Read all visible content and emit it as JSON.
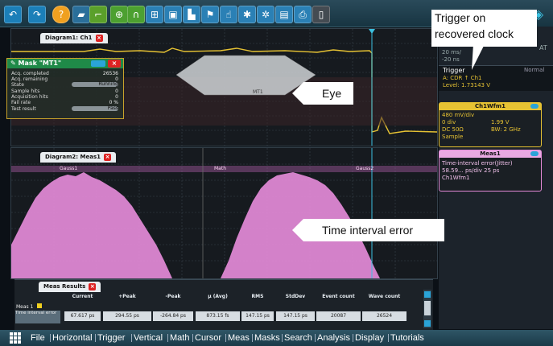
{
  "toolbar": {
    "icons": [
      "back-arrow-icon",
      "forward-arrow-icon",
      "help-icon",
      "folder-icon",
      "stairs-icon",
      "zoom-icon",
      "binoculars-icon",
      "grid-icon",
      "zoom-window-icon",
      "bookmark-icon",
      "flag-icon",
      "touch-icon",
      "gear-icon",
      "folder-open-icon",
      "printer-icon",
      "trash-icon",
      "nav-right-icon"
    ]
  },
  "diagram1": {
    "tab": "Diagram1: Ch1"
  },
  "mask": {
    "title": "Mask \"MT1\"",
    "rows": [
      {
        "label": "Acq. completed",
        "value": "26536"
      },
      {
        "label": "Acq. remaining",
        "value": "0"
      },
      {
        "label": "State",
        "value": "Running"
      },
      {
        "label": "Sample hits",
        "value": "0"
      },
      {
        "label": "Acquisition hits",
        "value": "0"
      },
      {
        "label": "Fail rate",
        "value": "0 %"
      },
      {
        "label": "Test result",
        "value": "Pass"
      }
    ],
    "mask_label": "MT1"
  },
  "diagram2": {
    "tab": "Diagram2: Meas1",
    "marker_left": "Gauss1",
    "marker_mid": "Math",
    "marker_right": "Gauss2"
  },
  "callouts": {
    "trigger": "Trigger on recovered clock",
    "eye": "Eye",
    "tie": "Time interval error"
  },
  "right_panel": {
    "timebase": [
      "20 ms/",
      "-20 ns"
    ],
    "trigger_label": "Trigger",
    "trigger_mode": "Normal",
    "trigger_source": "A:  CDR  ↑ Ch1",
    "trigger_level": "Level: 1.73143 V",
    "at_label": "AT",
    "ch1wfm1": {
      "title": "Ch1Wfm1",
      "lines": [
        "480 mV/div",
        "0 div",
        "1.99 V",
        "DC 50Ω",
        "BW: 2 GHz",
        "Sample"
      ]
    },
    "meas1": {
      "title": "Meas1",
      "lines": [
        "Time-interval error(Jitter)",
        "58.59... ps/div  25 ps",
        "Ch1Wfm1"
      ]
    }
  },
  "meas_results": {
    "tab": "Meas Results",
    "headers": [
      "Current",
      "+Peak",
      "-Peak",
      "μ (Avg)",
      "RMS",
      "StdDev",
      "Event count",
      "Wave count"
    ],
    "row_label": "Meas 1",
    "row_sublabel": "Time interval error",
    "values": [
      "67.617 ps",
      "294.55 ps",
      "-264.84 ps",
      "873.15 fs",
      "147.15 ps",
      "147.15 ps",
      "20087",
      "26524"
    ]
  },
  "menu": {
    "items": [
      "File",
      "Horizontal",
      "Trigger",
      "Vertical",
      "Math",
      "Cursor",
      "Meas",
      "Masks",
      "Search",
      "Analysis",
      "Display",
      "Tutorials"
    ]
  },
  "colors": {
    "waveform": "#e6c233",
    "histogram": "#e48ad8",
    "mask_fill": "#cfd3d6",
    "accent": "#1fb6d8"
  }
}
